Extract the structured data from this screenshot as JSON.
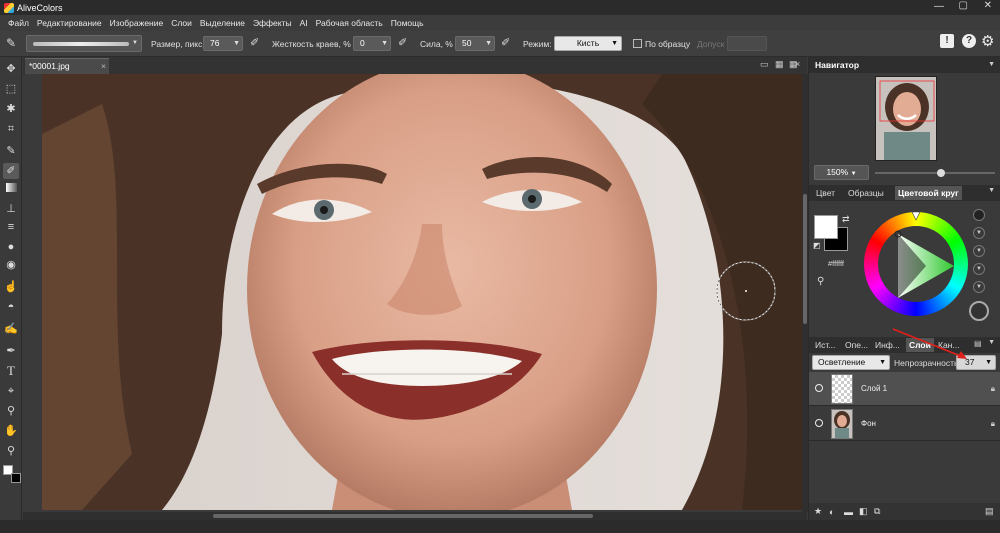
{
  "app": {
    "title": "AliveColors"
  },
  "menu": [
    "Файл",
    "Редактирование",
    "Изображение",
    "Слои",
    "Выделение",
    "Эффекты",
    "AI",
    "Рабочая область",
    "Помощь"
  ],
  "options": {
    "size_label": "Размер, пикс",
    "size_value": "76",
    "hardness_label": "Жесткость краев, %",
    "hardness_value": "0",
    "strength_label": "Сила, %",
    "strength_value": "50",
    "mode_label": "Режим:",
    "mode_value": "Кисть",
    "sample_label": "По образцу",
    "tolerance_label": "Допуск"
  },
  "document": {
    "tab_title": "*00001.jpg"
  },
  "navigator": {
    "title": "Навигатор",
    "zoom": "150%"
  },
  "color_panel": {
    "tabs": [
      "Цвет",
      "Образцы",
      "Цветовой круг"
    ],
    "active_tab": "Цветовой круг",
    "hex": "#ffffff",
    "colors": {
      "foreground": "#ffffff",
      "background": "#000000",
      "triangle": "#2ec82e"
    }
  },
  "layers_panel": {
    "tabs": [
      "Ист...",
      "Опе...",
      "Инф...",
      "Слои",
      "Кан..."
    ],
    "active_tab": "Слои",
    "blend_mode": "Осветление",
    "opacity_label": "Непрозрачность",
    "opacity_value": "37",
    "opacity_slider": 0.37,
    "layers": [
      {
        "name": "Слой 1"
      },
      {
        "name": "Фон"
      }
    ]
  },
  "icons": [
    "brush-icon",
    "help-icon",
    "settings-icon",
    "notice-icon"
  ]
}
